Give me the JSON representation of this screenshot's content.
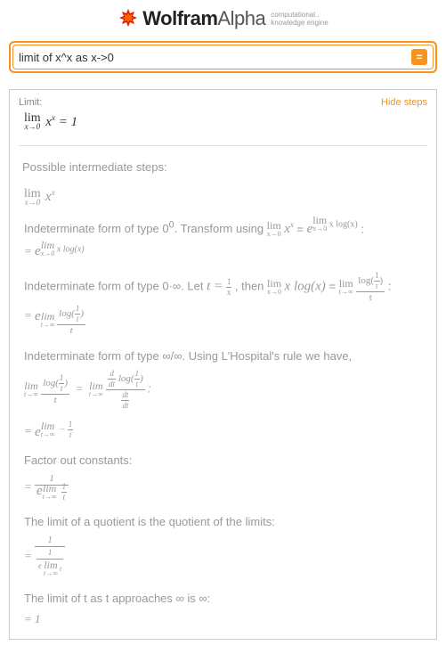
{
  "header": {
    "brand_bold": "Wolfram",
    "brand_light": "Alpha",
    "subtitle_line1": "computational..",
    "subtitle_line2": "knowledge engine"
  },
  "search": {
    "value": "limit of x^x as x->0"
  },
  "result": {
    "section_label": "Limit:",
    "hide_steps": "Hide steps",
    "answer_value": "= 1",
    "intermediate_title": "Possible intermediate steps:",
    "step_indet_00": "Indeterminate form of type 0",
    "step_indet_00_sup": "0",
    "step_indet_00_transform": ". Transform using ",
    "step_indet_0inf": "Indeterminate form of type 0·∞. Let ",
    "let_t": "t = ",
    "then_text": " , then ",
    "x_logx": " x log(x) ",
    "step_indet_infinf": "Indeterminate form of type ∞/∞. Using L'Hospital's rule we have,",
    "factor_out": "Factor out constants:",
    "quotient_limits": "The limit of a quotient is the quotient of the limits:",
    "limit_t_inf": "The limit of t as t approaches ∞ is ∞:",
    "final_eq": "= 1",
    "log_1t": "log",
    "dtdt": "dt",
    "lim": "lim",
    "x_arr_0": "x→0",
    "t_arr_inf": "t→∞",
    "x_pow_x": "x",
    "x_pow_x_sup": "x",
    "e_sym": "e",
    "eq": "=",
    "one": "1",
    "t_sym": "t",
    "minus_1t": "−",
    "d_dt": "d"
  }
}
